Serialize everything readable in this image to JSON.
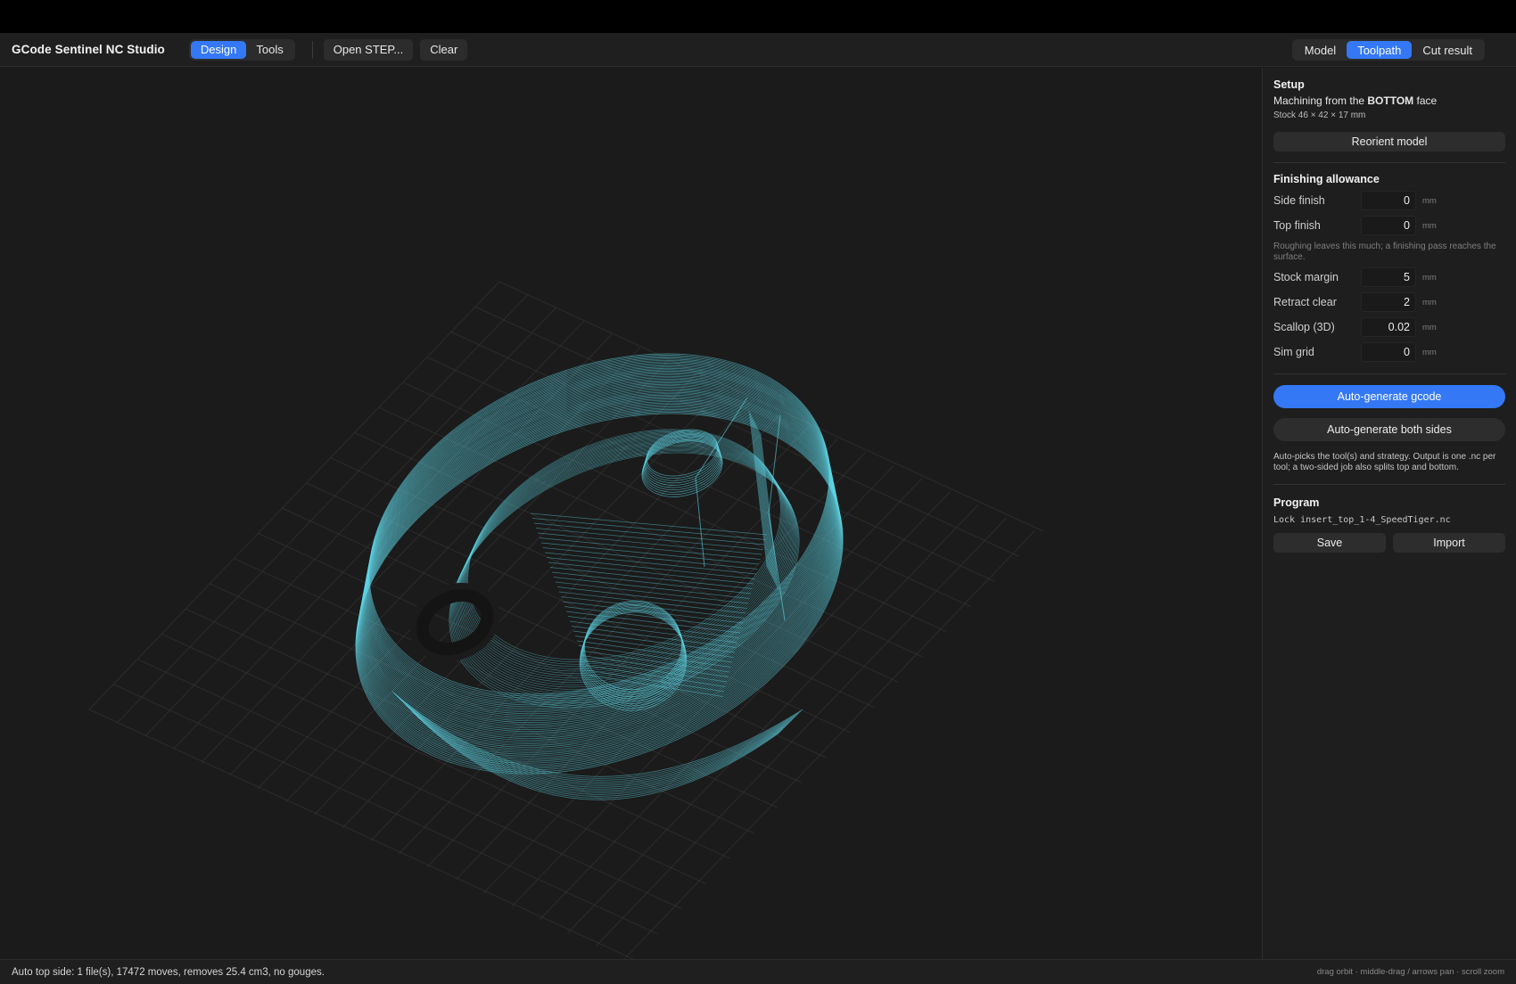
{
  "app": {
    "title": "GCode Sentinel NC Studio"
  },
  "toolbar": {
    "mode_tabs": [
      {
        "label": "Design",
        "active": true
      },
      {
        "label": "Tools",
        "active": false
      }
    ],
    "open_step_label": "Open STEP...",
    "clear_label": "Clear",
    "view_tabs": [
      {
        "label": "Model",
        "active": false
      },
      {
        "label": "Toolpath",
        "active": true
      },
      {
        "label": "Cut result",
        "active": false
      }
    ]
  },
  "panel": {
    "setup": {
      "title": "Setup",
      "machining_prefix": "Machining from the",
      "machining_face": "BOTTOM",
      "machining_suffix": "face",
      "stock": "Stock 46 × 42 × 17 mm",
      "reorient_label": "Reorient model"
    },
    "finishing": {
      "title": "Finishing allowance",
      "side_finish": {
        "label": "Side finish",
        "value": "0",
        "unit": "mm"
      },
      "top_finish": {
        "label": "Top finish",
        "value": "0",
        "unit": "mm"
      },
      "hint": "Roughing leaves this much; a finishing pass reaches the surface.",
      "stock_margin": {
        "label": "Stock margin",
        "value": "5",
        "unit": "mm"
      },
      "retract_clear": {
        "label": "Retract clear",
        "value": "2",
        "unit": "mm"
      },
      "scallop": {
        "label": "Scallop (3D)",
        "value": "0.02",
        "unit": "mm"
      },
      "sim_grid": {
        "label": "Sim grid",
        "value": "0",
        "unit": "mm"
      }
    },
    "generate": {
      "auto_label": "Auto-generate gcode",
      "both_label": "Auto-generate both sides",
      "note": "Auto-picks the tool(s) and strategy. Output is one .nc per tool; a two-sided job also splits top and bottom."
    },
    "program": {
      "title": "Program",
      "file": "Lock insert_top_1-4_SpeedTiger.nc",
      "save_label": "Save",
      "import_label": "Import"
    }
  },
  "colors": {
    "accent": "#3478f6",
    "toolpath": "#5fd6e6",
    "grid": "#3a3a3a"
  },
  "status": {
    "message": "Auto top side: 1 file(s), 17472 moves, removes 25.4 cm3, no gouges.",
    "hint": "drag orbit · middle-drag / arrows pan · scroll zoom"
  }
}
